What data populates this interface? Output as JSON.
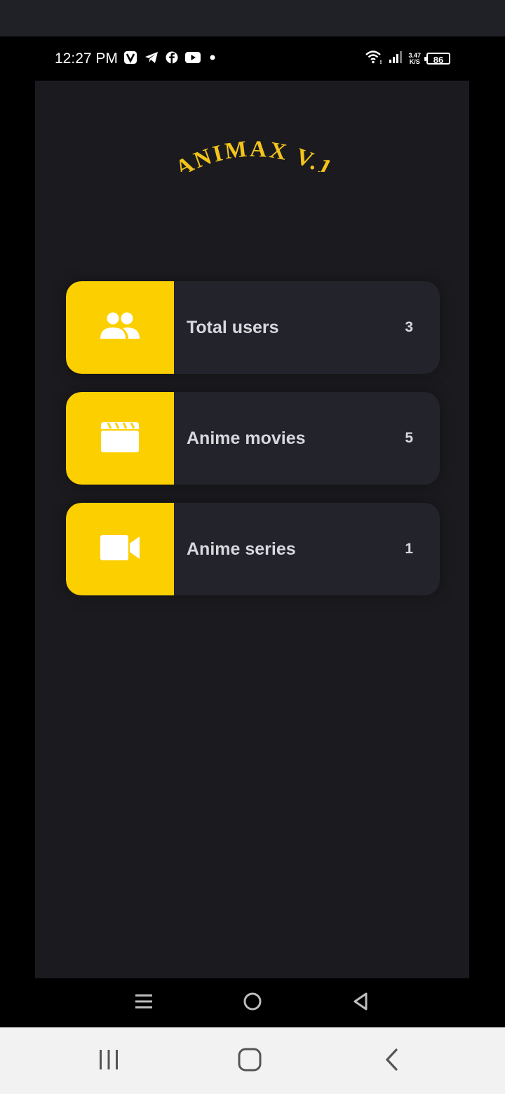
{
  "status_bar": {
    "time": "12:27 PM",
    "net_speed_value": "3.47",
    "net_speed_unit": "K/S",
    "battery": "86",
    "icons_left": [
      "vpn-icon",
      "telegram-icon",
      "facebook-icon",
      "youtube-icon",
      "dot-icon"
    ],
    "icons_right": [
      "wifi-icon",
      "signal-icon",
      "net-speed",
      "battery-icon"
    ]
  },
  "app": {
    "title": "ANIMAX V.1",
    "accent_color": "#fccf00",
    "background_color": "#1b1b1f",
    "card_color": "#22232b",
    "stats": [
      {
        "label": "Total users",
        "count": "3",
        "icon": "users-icon"
      },
      {
        "label": "Anime movies",
        "count": "5",
        "icon": "clapperboard-icon"
      },
      {
        "label": "Anime series",
        "count": "1",
        "icon": "video-camera-icon"
      }
    ]
  },
  "app_nav": {
    "buttons": [
      "menu-icon",
      "home-circle-icon",
      "back-triangle-icon"
    ]
  },
  "system_nav": {
    "buttons": [
      "recents-icon",
      "home-icon",
      "back-icon"
    ]
  }
}
